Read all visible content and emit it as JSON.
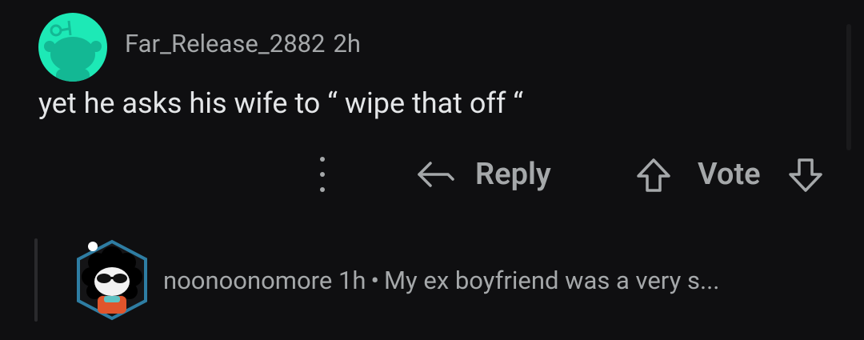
{
  "comment": {
    "username": "Far_Release_2882",
    "time": "2h",
    "body": "yet he asks his wife to “ wipe that off “"
  },
  "actions": {
    "reply_label": "Reply",
    "vote_label": "Vote"
  },
  "reply": {
    "username": "noonoonomore",
    "time": "1h",
    "separator": "•",
    "preview": "My ex boyfriend was a very s..."
  },
  "colors": {
    "background": "#0f0f11",
    "avatar_teal": "#1de9b6",
    "muted_text": "#a5a8aa",
    "body_text": "#e4e6e8"
  },
  "icons": {
    "more": "more-vertical-icon",
    "reply": "reply-arrow-icon",
    "upvote": "upvote-arrow-icon",
    "downvote": "downvote-arrow-icon"
  }
}
